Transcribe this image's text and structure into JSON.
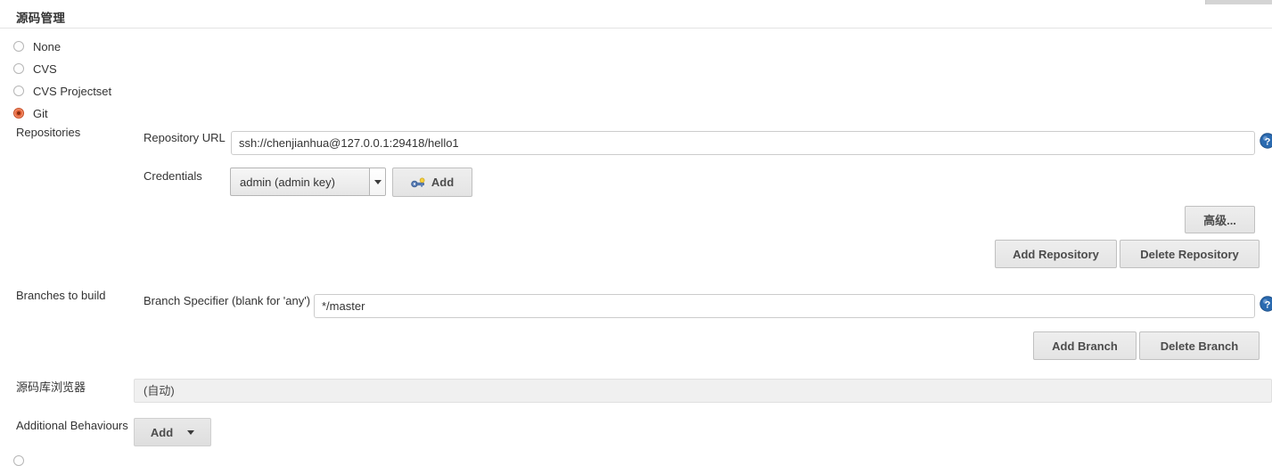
{
  "section": {
    "title": "源码管理"
  },
  "scm_options": [
    {
      "label": "None",
      "selected": false
    },
    {
      "label": "CVS",
      "selected": false
    },
    {
      "label": "CVS Projectset",
      "selected": false
    },
    {
      "label": "Git",
      "selected": true
    }
  ],
  "repositories": {
    "label": "Repositories",
    "repository_url": {
      "label": "Repository URL",
      "value": "ssh://chenjianhua@127.0.0.1:29418/hello1",
      "placeholder": ""
    },
    "credentials": {
      "label": "Credentials",
      "selected": "admin (admin key)",
      "options": [
        "admin (admin key)"
      ],
      "add_button": "Add",
      "add_icon": "key-icon"
    },
    "advanced_button": "高级...",
    "add_repository_button": "Add Repository",
    "delete_repository_button": "Delete Repository"
  },
  "branches": {
    "label": "Branches to build",
    "branch_specifier": {
      "label": "Branch Specifier (blank for 'any')",
      "value": "*/master",
      "placeholder": ""
    },
    "add_branch_button": "Add Branch",
    "delete_branch_button": "Delete Branch"
  },
  "repository_browser": {
    "label": "源码库浏览器",
    "selected": "(自动)",
    "options": [
      "(自动)"
    ]
  },
  "additional_behaviours": {
    "label": "Additional Behaviours",
    "add_button": "Add"
  },
  "icons": {
    "help": "help-icon",
    "chevron_down": "chevron-down-icon"
  },
  "colors": {
    "radio_selected": "#e8653a",
    "help_icon": "#2a6ab0",
    "text": "#333333",
    "button_face": "#e7e7e7",
    "divider": "#e3e3e3"
  }
}
